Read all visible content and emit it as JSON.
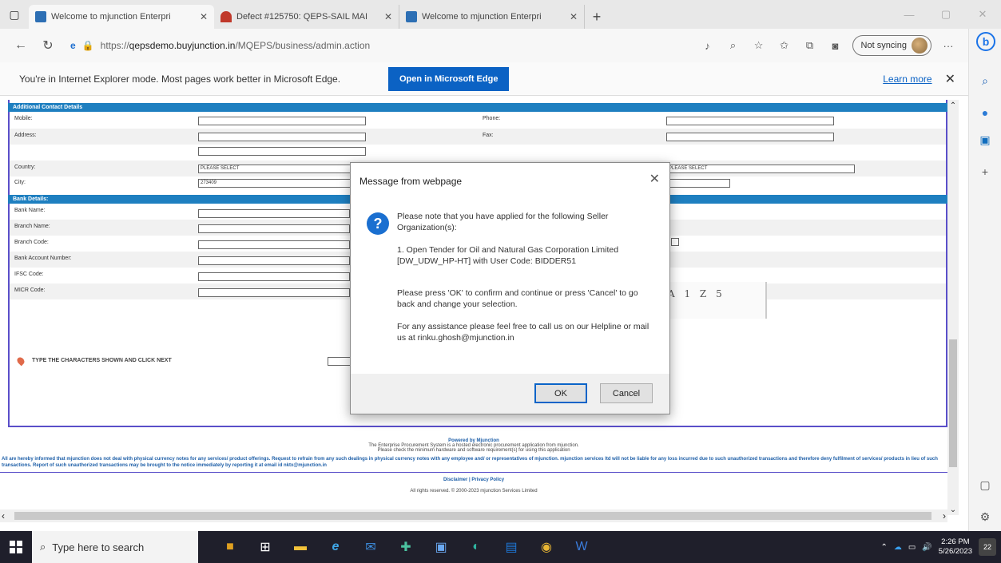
{
  "browser": {
    "tabs": [
      {
        "label": "Welcome to mjunction Enterpri",
        "favicon_color": "#2d6fb4",
        "active": true
      },
      {
        "label": "Defect #125750: QEPS-SAIL MAI",
        "favicon_color": "#c0392b",
        "active": false
      },
      {
        "label": "Welcome to mjunction Enterpri",
        "favicon_color": "#2d6fb4",
        "active": false
      }
    ],
    "url_prefix": "https://",
    "url_host": "qepsdemo.buyjunction.in",
    "url_path": "/MQEPS/business/admin.action",
    "sync_label": "Not syncing",
    "ie_bar": {
      "message": "You're in Internet Explorer mode. Most pages work better in Microsoft Edge.",
      "open_button": "Open in Microsoft Edge",
      "learn_more": "Learn more"
    }
  },
  "form": {
    "contact_section": "Additional Contact Details",
    "bank_section": "Bank Details:",
    "contact_rows": [
      {
        "label": "Mobile:",
        "label2": "Phone:"
      },
      {
        "label": "Address:",
        "label2": "Fax:"
      },
      {
        "label": "",
        "label2": ""
      },
      {
        "label": "Country:",
        "label2": "",
        "value": "PLEASE SELECT",
        "value2": "PLEASE SELECT"
      },
      {
        "label": "City:",
        "label2": "",
        "value": "273409"
      }
    ],
    "bank_rows": [
      {
        "label": "Bank Name:"
      },
      {
        "label": "Branch Name:"
      },
      {
        "label": "Branch Code:"
      },
      {
        "label": "Bank Account Number:"
      },
      {
        "label": "IFSC Code:"
      },
      {
        "label": "MICR Code:"
      }
    ],
    "captcha_label": "TYPE THE CHARACTERS SHOWN AND CLICK NEXT",
    "captcha_text": "A 1 Z 5"
  },
  "footer": {
    "powered_by": "Powered by Mjunction",
    "line1": "The Enterprise Procurement System is a hosted electronic procurement application from mjunction.",
    "line2": "Please check the minimum hardware and software requirement(s) for using this application",
    "notice": "All are hereby informed that mjunction does not deal with physical currency notes for any services/ product offerings. Request to refrain from any such dealings in physical currency notes with any employee and/ or representatives of mjunction. mjunction services ltd will not be liable for any loss incurred due to such unauthorized transactions and therefore deny fulfilment of services/ products in lieu of such transactions. Report of such unauthorized transactions may be brought to the notice immediately by reporting it at email id nktx@mjunction.in",
    "links": "Disclaimer | Privacy Policy",
    "copyright": "All rights reserved. © 2000-2023 mjunction Services Limited"
  },
  "dialog": {
    "title": "Message from webpage",
    "p1": "Please note that you have applied for the following Seller Organization(s):",
    "p2": "1. Open Tender for Oil and Natural Gas Corporation Limited [DW_UDW_HP-HT] with User Code: BIDDER51",
    "p3": "Please press 'OK' to confirm and continue or press 'Cancel' to go back and change your selection.",
    "p4": "For any assistance please feel free to call us on our Helpline or mail us at rinku.ghosh@mjunction.in",
    "ok": "OK",
    "cancel": "Cancel"
  },
  "taskbar": {
    "search_placeholder": "Type here to search",
    "time": "2:26 PM",
    "date": "5/26/2023",
    "notifications": "22"
  }
}
